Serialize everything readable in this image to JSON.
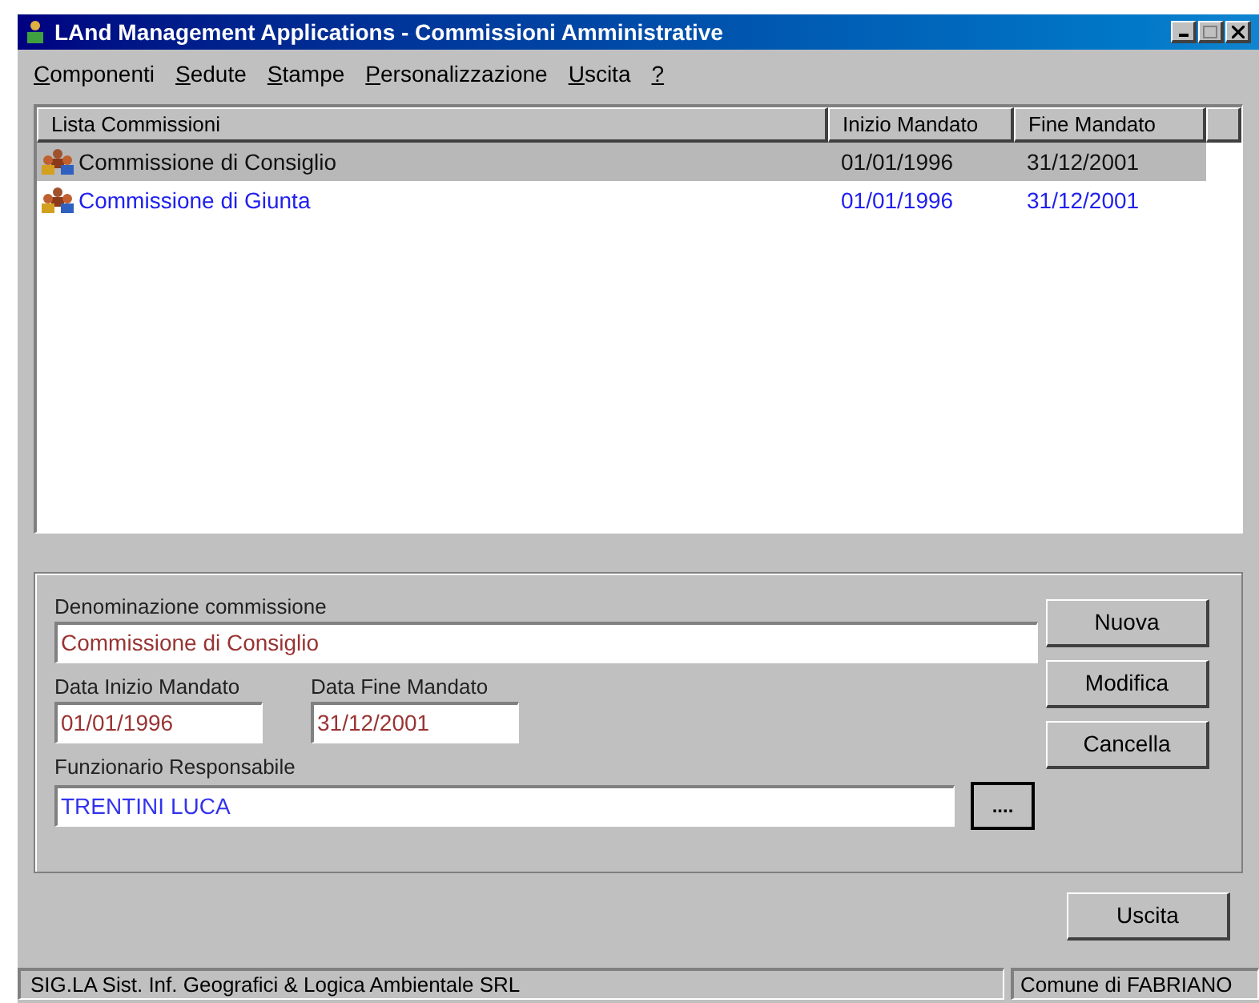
{
  "window": {
    "title": "LAnd Management Applications - Commissioni Amministrative"
  },
  "menu": [
    "Componenti",
    "Sedute",
    "Stampe",
    "Personalizzazione",
    "Uscita",
    "?"
  ],
  "list": {
    "columns": [
      "Lista Commissioni",
      "Inizio Mandato",
      "Fine Mandato"
    ],
    "rows": [
      {
        "name": "Commissione di Consiglio",
        "start": "01/01/1996",
        "end": "31/12/2001",
        "selected": true
      },
      {
        "name": "Commissione di Giunta",
        "start": "01/01/1996",
        "end": "31/12/2001",
        "selected": false
      }
    ]
  },
  "form": {
    "name": {
      "label": "Denominazione commissione",
      "value": "Commissione di Consiglio",
      "color": "#993333"
    },
    "start": {
      "label": "Data Inizio Mandato",
      "value": "01/01/1996",
      "color": "#993333"
    },
    "end": {
      "label": "Data Fine Mandato",
      "value": "31/12/2001",
      "color": "#993333"
    },
    "official": {
      "label": "Funzionario Responsabile",
      "value": "TRENTINI  LUCA",
      "color": "#3333ee"
    },
    "browse_button": "...."
  },
  "buttons": [
    "Nuova",
    "Modifica",
    "Cancella"
  ],
  "exit_button": "Uscita",
  "status_bar": [
    "SIG.LA Sist. Inf. Geografici & Logica Ambientale SRL",
    "Comune di FABRIANO"
  ]
}
